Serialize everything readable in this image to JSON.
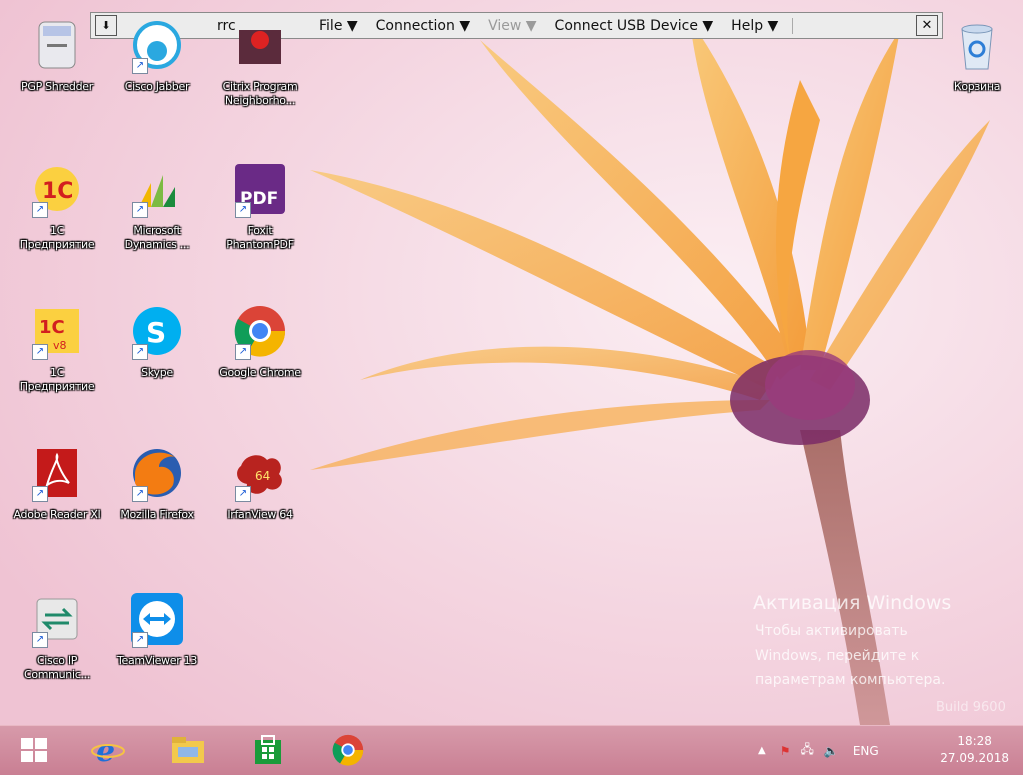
{
  "toolbar": {
    "title": "rrc",
    "menus": [
      "File ▼",
      "Connection ▼",
      "View ▼",
      "Connect USB Device ▼",
      "Help ▼"
    ]
  },
  "desktop_icons": [
    {
      "label": "PGP Shredder"
    },
    {
      "label": "Cisco Jabber"
    },
    {
      "label": "Citrix Program Neighborho..."
    },
    {
      "label": "1С Предприятие"
    },
    {
      "label": "Microsoft Dynamics ..."
    },
    {
      "label": "Foxit PhantomPDF"
    },
    {
      "label": "1С Предприятие"
    },
    {
      "label": "Skype"
    },
    {
      "label": "Google Chrome"
    },
    {
      "label": "Adobe Reader XI"
    },
    {
      "label": "Mozilla Firefox"
    },
    {
      "label": "IrfanView 64"
    },
    {
      "label": "Cisco IP Communic..."
    },
    {
      "label": "TeamViewer 13"
    },
    {
      "label": "Корзина"
    }
  ],
  "watermark": {
    "title": "Активация Windows",
    "line1": "Чтобы активировать",
    "line2": "Windows, перейдите к",
    "line3": "параметрам компьютера.",
    "build": "Build 9600"
  },
  "tray": {
    "lang": "ENG",
    "time": "18:28",
    "date": "27.09.2018"
  }
}
